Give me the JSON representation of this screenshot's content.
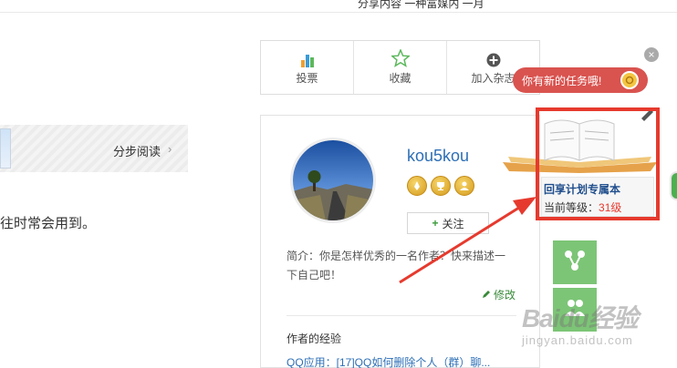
{
  "top": {
    "text": "分享内容 一种富媒内 一月"
  },
  "step": {
    "label": "分步阅读",
    "chevron": "›"
  },
  "body": {
    "text": "往时常会用到。"
  },
  "actions": [
    {
      "label": "投票",
      "icon": "bar-chart-icon"
    },
    {
      "label": "收藏",
      "icon": "star-icon"
    },
    {
      "label": "加入杂志",
      "icon": "plus-circle-icon"
    }
  ],
  "profile": {
    "username": "kou5kou",
    "follow_label": "关注",
    "follow_icon": "+",
    "intro": "简介：你是怎样优秀的一名作者？快来描述一下自己吧！",
    "edit_label": "修改",
    "experience_title": "作者的经验",
    "experience_link": "QQ应用：[17]QQ如何删除个人（群）聊..."
  },
  "popup": {
    "bubble_text": "你有新的任务哦!",
    "title": "回享计划专属本",
    "level_label": "当前等级：",
    "level_value": "31级",
    "close": "×"
  },
  "watermark": {
    "main": "Baidu经验",
    "sub": "jingyan.baidu.com"
  },
  "colors": {
    "accent_red": "#e63a2e",
    "link_blue": "#2d6fb6",
    "green": "#7cc576"
  }
}
